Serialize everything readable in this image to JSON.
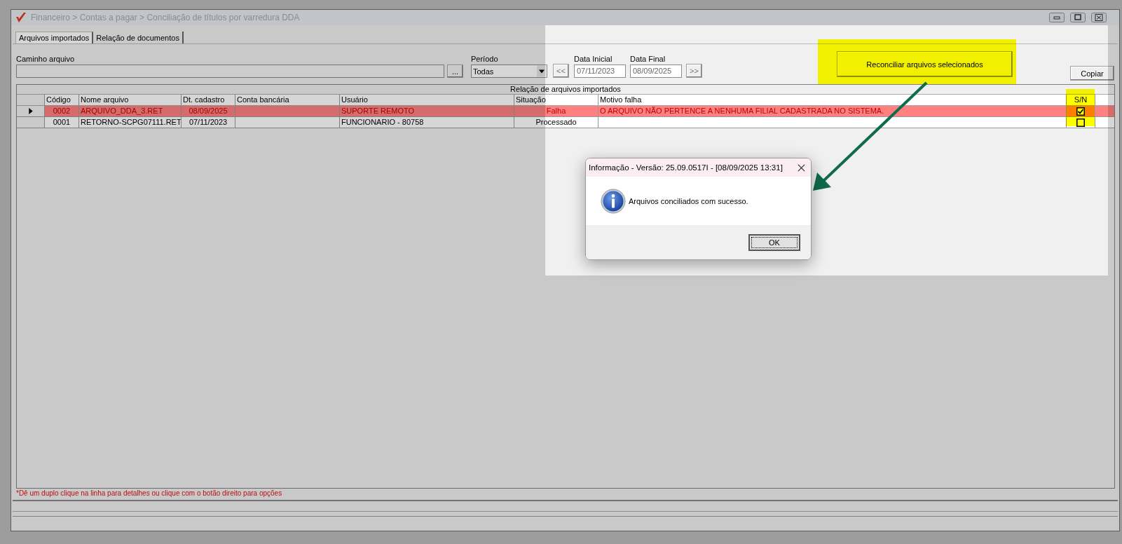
{
  "window": {
    "title": "Financeiro > Contas a pagar > Conciliação de títulos por varredura DDA"
  },
  "tabs": [
    {
      "label": "Arquivos importados",
      "selected": true
    },
    {
      "label": "Relação de documentos",
      "selected": false
    }
  ],
  "file_path": {
    "label": "Caminho arquivo",
    "browse_button": "..."
  },
  "period": {
    "label": "Período",
    "value": "Todas"
  },
  "date_range": {
    "prev_button": "<<",
    "start_label": "Data Inicial",
    "start_value": "07/11/2023",
    "end_label": "Data Final",
    "end_value": "08/09/2025",
    "next_button": ">>"
  },
  "reconcile_button": "Reconciliar arquivos selecionados",
  "copy_button": "Copiar",
  "table": {
    "title": "Relação de arquivos importados",
    "columns": [
      "Código",
      "Nome arquivo",
      "Dt. cadastro",
      "Conta bancária",
      "Usuário",
      "Situação",
      "Motivo falha"
    ],
    "check_column": "S/N",
    "rows": [
      {
        "selected": true,
        "color": "#ff8080",
        "checked": true,
        "cells": [
          "0002",
          "ARQUIVO_DDA_3.RET",
          "08/09/2025",
          null,
          "SUPORTE REMOTO",
          "Falha",
          "O ARQUIVO NÃO PERTENCE A NENHUMA FILIAL CADASTRADA NO SISTEMA."
        ]
      },
      {
        "selected": false,
        "color": "#ffffff",
        "checked": false,
        "cells": [
          "0001",
          "RETORNO-SCPG07111.RET",
          "07/11/2023",
          null,
          "FUNCIONARIO - 80758",
          "Processado",
          null
        ]
      }
    ]
  },
  "note": "*Dê um duplo clique na linha para detalhes ou clique com o botão direito para opções",
  "dialog": {
    "title": "Informação - Versão: 25.09.0517I - [08/09/2025 13:31]",
    "message": "Arquivos conciliados com sucesso.",
    "ok_button": "OK"
  }
}
